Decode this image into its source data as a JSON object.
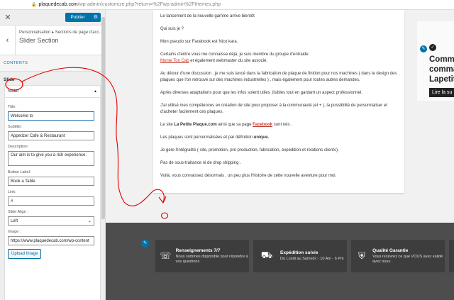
{
  "browser": {
    "host": "plaquedecab.com",
    "path": "/wp-admin/customize.php?return=%2Fwp-admin%2Fthemes.php"
  },
  "customizer": {
    "close": "✕",
    "publish_label": "Publier",
    "breadcrumb": "Personnalisation ▸ Sections de page d'acc...",
    "section_title": "Slider Section",
    "section_heading": "CONTENTS",
    "group_label": "Slide",
    "accordion_label": "Slider",
    "fields": {
      "title_label": "Title:",
      "title_value": "Welcome to",
      "subtitle_label": "Subtitle:",
      "subtitle_value": "Appetizer Cafe & Restaurant",
      "description_label": "Description:",
      "description_value": "Our aim is to give you a rich experience.",
      "button_label_label": "Button Label:",
      "button_label_value": "Book a Table",
      "link_label": "Link:",
      "link_value": "#",
      "slide_align_label": "Slide Align :",
      "slide_align_value": "Left",
      "image_label": "Image :",
      "image_value": "https://www.plaquedecab.com/wp-content",
      "upload_button": "Upload Image"
    }
  },
  "article": {
    "p1": "Le lancement de la nouvelle gamme arrive bientôt",
    "p2": "Qui suis je ?",
    "p3": "Mon pseudo sur Facebook est Nico kara.",
    "p4a": "Certains d'entre vous me connaisse déjà, je suis membre du groupe d'entraide",
    "p4link": "Monte Ton Cab",
    "p4b": " et également webmaster du site associé.",
    "p5": "Au détour d'une discussion , je me suis lancé dans la fabrication de plaque de finition pour nos machines ( dans le design des plaques que l'on retrouve sur des machines industrielles ) , mais également pour toutes autres demandes.",
    "p6": "Après diverses adaptations pour que les infos soient utiles ,lisibles tout en gardant un aspect professionnel.",
    "p7": "J'ai utilisé mes compétences en création de site pour proposer à la communauté (et + ), la possibilité de personnaliser et d'acheter facilement ces plaques.",
    "p8a": "Le site ",
    "p8b": "La Petite Plaque.com",
    "p8c": " ainsi que sa page  ",
    "p8link": "Facebook",
    "p8d": " sont nés .",
    "p9a": "Les plaques sont personnalisées et par définition ",
    "p9b": "unique.",
    "p10": "Je gère l'intégralité ( site, promotion, pré production, fabrication, expédition et relations clients).",
    "p11": "Pas de sous-traitance ni de drop shipping .",
    "p12": "Voilà, vous connaissez désormais , un peu plus l'histoire de cette nouvelle aventure pour moi."
  },
  "right_card": {
    "headline_1": "Comm",
    "headline_2": "comma",
    "headline_3": "Lapetit",
    "button": "Lire la su"
  },
  "footer": {
    "cards": [
      {
        "icon": "phone-check-icon",
        "title": "Renseignements 7/7",
        "desc": "Nous sommes disponible pour répondre à vos questions"
      },
      {
        "icon": "truck-icon",
        "title": "Expédition suivie",
        "desc": "Du Lundi au Samedi :- 10 Am - 6 Pm"
      },
      {
        "icon": "shield-check-icon",
        "title": "Qualité Garantie",
        "desc": "Vous recevrez ce que VOUS avez validé avec nous ."
      }
    ]
  },
  "colors": {
    "wp_blue": "#0073aa",
    "annotation_red": "#e00000",
    "footer_bg": "#4d4d4d"
  }
}
